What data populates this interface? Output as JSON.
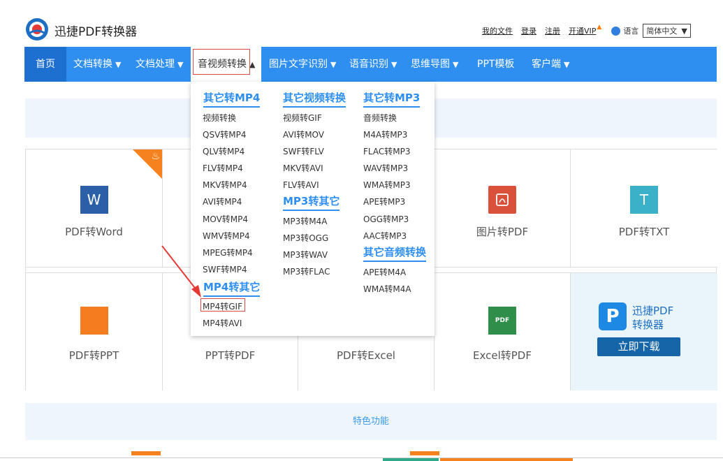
{
  "header": {
    "app_title": "迅捷PDF转换器",
    "links": [
      "我的文件",
      "登录",
      "注册",
      "开通VIP"
    ],
    "lang_label": "语言",
    "lang_value": "简体中文"
  },
  "nav": {
    "items": [
      "首页",
      "文档转换",
      "文档处理",
      "音视频转换",
      "图片文字识别",
      "语音识别",
      "思维导图",
      "PPT模板",
      "客户端"
    ]
  },
  "dropdown": {
    "col1": {
      "head1": "其它转MP4",
      "items1": [
        "视频转换",
        "QSV转MP4",
        "QLV转MP4",
        "FLV转MP4",
        "MKV转MP4",
        "AVI转MP4",
        "MOV转MP4",
        "WMV转MP4",
        "MPEG转MP4",
        "SWF转MP4"
      ],
      "head2": "MP4转其它",
      "items2": [
        "MP4转GIF",
        "MP4转AVI"
      ]
    },
    "col2": {
      "head1": "其它视频转换",
      "items1": [
        "视频转GIF",
        "AVI转MOV",
        "SWF转FLV",
        "MKV转AVI",
        "FLV转AVI"
      ],
      "head2": "MP3转其它",
      "items2": [
        "MP3转M4A",
        "MP3转OGG",
        "MP3转WAV",
        "MP3转FLAC"
      ]
    },
    "col3": {
      "head1": "其它转MP3",
      "items1": [
        "音频转换",
        "M4A转MP3",
        "FLAC转MP3",
        "WAV转MP3",
        "WMA转MP3",
        "APE转MP3",
        "OGG转MP3",
        "AAC转MP3"
      ],
      "head2": "其它音频转换",
      "items2": [
        "APE转M4A",
        "WMA转M4A"
      ]
    }
  },
  "cards": {
    "row1": [
      "PDF转Word",
      "",
      "",
      "图片转PDF",
      "PDF转TXT"
    ],
    "row2": [
      "PDF转PPT",
      "PPT转PDF",
      "PDF转Excel",
      "Excel转PDF"
    ],
    "icons": {
      "word": "W",
      "txt": "T",
      "pdf_img": "⚲",
      "excel": "PDF"
    },
    "download": {
      "title_line1": "迅捷PDF",
      "title_line2": "转换器",
      "button": "立即下载"
    }
  },
  "feature_band": "特色功能",
  "colors": {
    "nav": "#2e8ff0",
    "accent_orange": "#f5821f",
    "word_blue": "#2b5fa8",
    "img_red": "#d9503b",
    "txt_teal": "#3bb0c9",
    "excel_green": "#2f8f4a",
    "ppt_orange": "#f57c1f"
  }
}
